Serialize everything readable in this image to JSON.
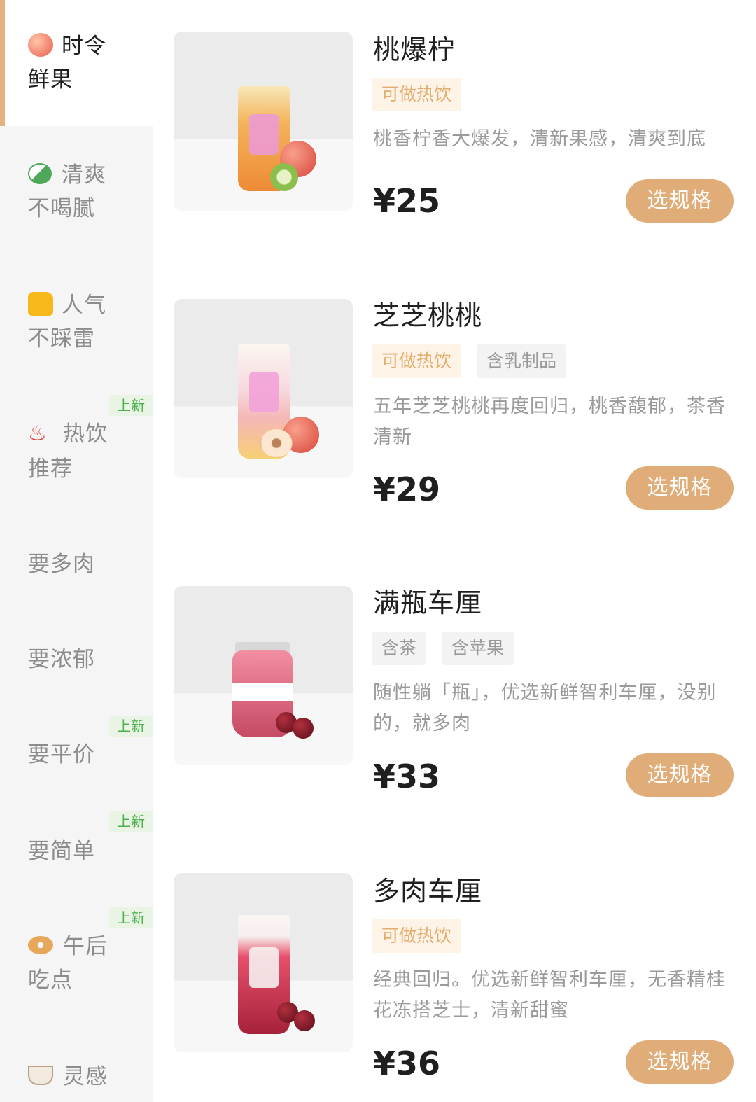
{
  "sidebar": {
    "categories": [
      {
        "line1": "时令",
        "line2": "鲜果",
        "icon": "peach-icon",
        "active": true
      },
      {
        "line1": "清爽",
        "line2": "不喝腻",
        "icon": "leaf-icon"
      },
      {
        "line1": "人气",
        "line2": "不踩雷",
        "icon": "thumbs-up-icon"
      },
      {
        "line1": "热饮",
        "line2": "推荐",
        "icon": "hot-springs-icon",
        "badge": "上新"
      },
      {
        "line1": "要多肉",
        "line2": ""
      },
      {
        "line1": "要浓郁",
        "line2": ""
      },
      {
        "line1": "要平价",
        "line2": "",
        "badge": "上新"
      },
      {
        "line1": "要简单",
        "line2": "",
        "badge": "上新"
      },
      {
        "line1": "午后",
        "line2": "吃点",
        "icon": "bagel-icon",
        "badge": "上新"
      },
      {
        "line1": "灵感",
        "line2": "",
        "icon": "coffee-icon"
      }
    ]
  },
  "products": [
    {
      "name": "桃爆柠",
      "tags": [
        "可做热饮"
      ],
      "desc": "桃香柠香大爆发，清新果感，清爽到底",
      "price": "¥25",
      "button": "选规格"
    },
    {
      "name": "芝芝桃桃",
      "tags": [
        "可做热饮",
        "含乳制品"
      ],
      "desc": "五年芝芝桃桃再度回归，桃香馥郁，茶香清新",
      "price": "¥29",
      "button": "选规格"
    },
    {
      "name": "满瓶车厘",
      "tags": [
        "含茶",
        "含苹果"
      ],
      "desc": "随性躺「瓶」，优选新鲜智利车厘，没别的，就多肉",
      "price": "¥33",
      "button": "选规格"
    },
    {
      "name": "多肉车厘",
      "tags": [
        "可做热饮"
      ],
      "desc": "经典回归。优选新鲜智利车厘，无香精桂花冻搭芝士，清新甜蜜",
      "price": "¥36",
      "button": "选规格"
    }
  ],
  "colors": {
    "accent": "#e0ad78",
    "tag_hot_bg": "#fdf3e6",
    "tag_hot_text": "#e5ad6d",
    "new_badge_text": "#4caf50",
    "sidebar_bg": "#f5f5f5"
  }
}
